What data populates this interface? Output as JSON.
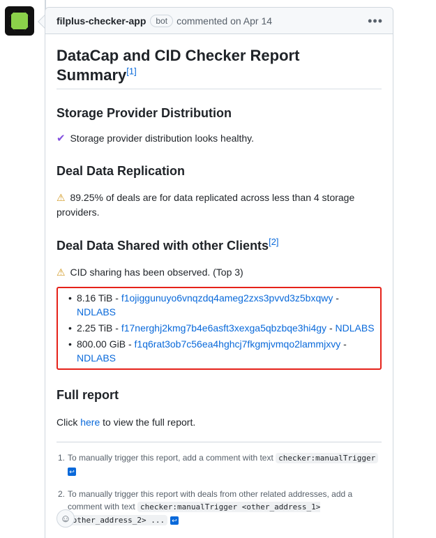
{
  "comment": {
    "author": "filplus-checker-app",
    "badge": "bot",
    "meta": "commented on Apr 14"
  },
  "report": {
    "title": "DataCap and CID Checker Report Summary",
    "title_footnote": "[1]",
    "sections": {
      "spd": {
        "heading": "Storage Provider Distribution",
        "text": "Storage provider distribution looks healthy."
      },
      "ddr": {
        "heading": "Deal Data Replication",
        "text": "89.25% of deals are for data replicated across less than 4 storage providers."
      },
      "dds": {
        "heading": "Deal Data Shared with other Clients",
        "footnote": "[2]",
        "text": "CID sharing has been observed. (Top 3)",
        "items": [
          {
            "size": "8.16 TiB",
            "address": "f1ojiggunuyo6vnqzdq4ameg2zxs3pvvd3z5bxqwy",
            "client": "NDLABS"
          },
          {
            "size": "2.25 TiB",
            "address": "f17nerghj2kmg7b4e6asft3xexga5qbzbqe3hi4gy",
            "client": "NDLABS"
          },
          {
            "size": "800.00 GiB",
            "address": "f1q6rat3ob7c56ea4hghcj7fkgmjvmqo2lammjxvy",
            "client": "NDLABS"
          }
        ]
      },
      "full": {
        "heading": "Full report",
        "text_before": "Click ",
        "link": "here",
        "text_after": " to view the full report."
      }
    },
    "footnotes": [
      {
        "num": "1.",
        "text": "To manually trigger this report, add a comment with text ",
        "code": "checker:manualTrigger"
      },
      {
        "num": "2.",
        "text": "To manually trigger this report with deals from other related addresses, add a comment with text ",
        "code": "checker:manualTrigger <other_address_1> <other_address_2> ..."
      }
    ]
  },
  "icons": {
    "check": "✔",
    "warning": "⚠",
    "kebab": "•••",
    "emoji": "☺",
    "backref": "↩"
  },
  "colors": {
    "accent_link": "#0969da",
    "highlight_border": "#e5221a",
    "check_purple": "#8250df",
    "warning_yellow": "#d29922"
  }
}
